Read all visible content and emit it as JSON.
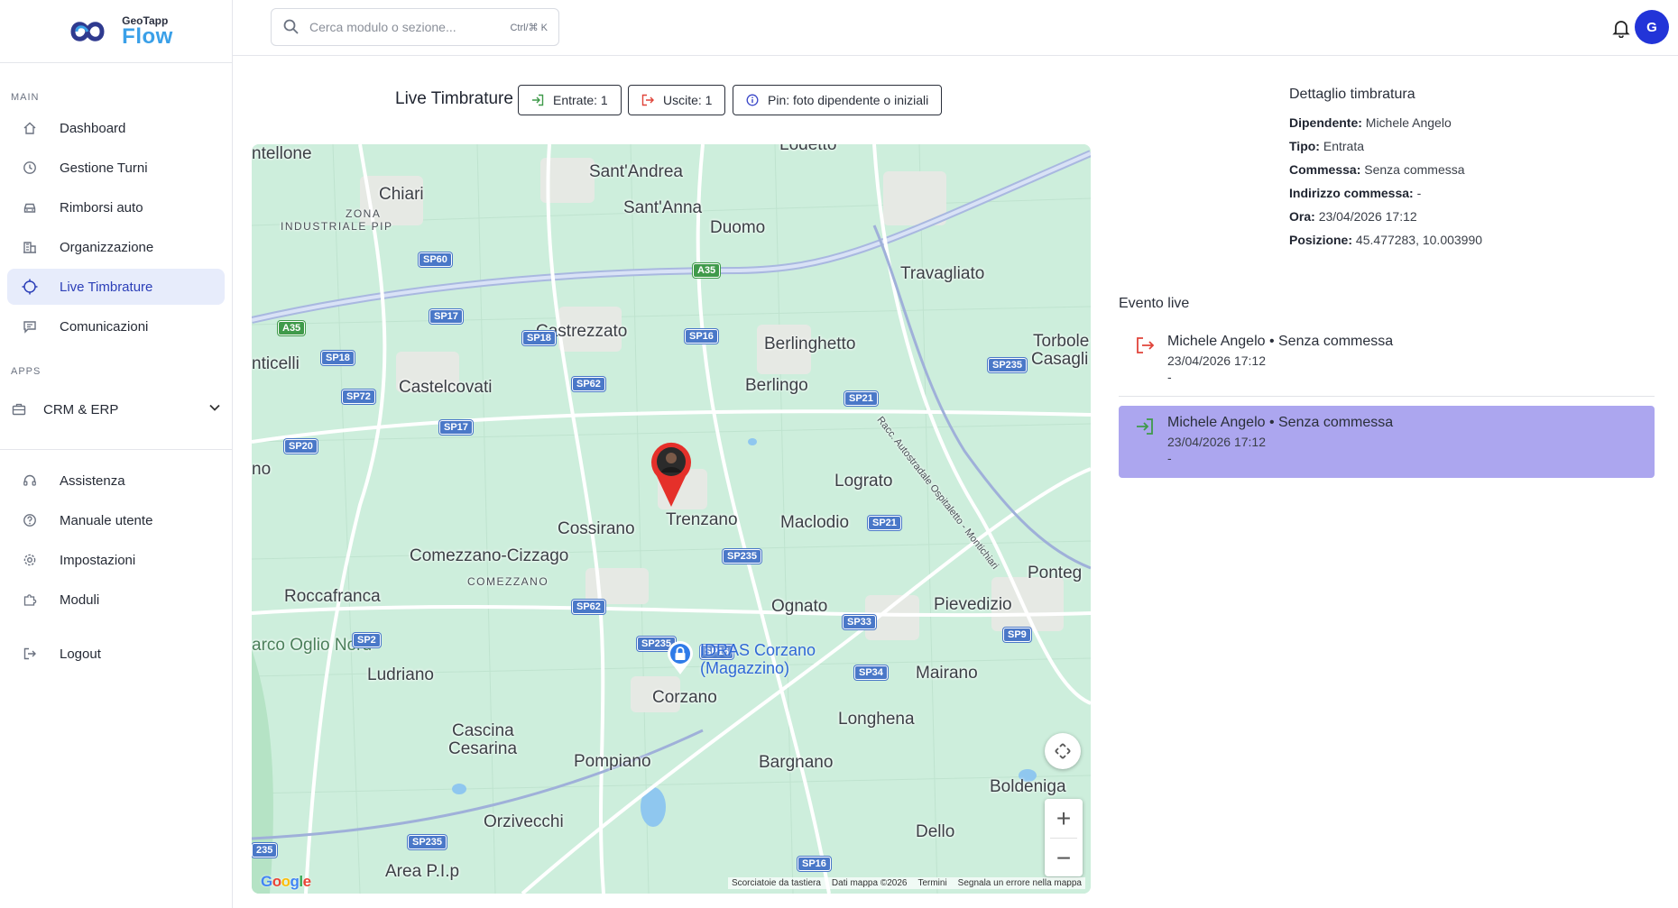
{
  "app": {
    "logo_top": "GeoTapp",
    "logo_bottom": "Flow"
  },
  "sidebar": {
    "main_label": "MAIN",
    "apps_label": "APPS",
    "items": [
      {
        "label": "Dashboard",
        "icon": "home-icon"
      },
      {
        "label": "Gestione Turni",
        "icon": "clock-icon"
      },
      {
        "label": "Rimborsi auto",
        "icon": "car-icon"
      },
      {
        "label": "Organizzazione",
        "icon": "building-icon"
      },
      {
        "label": "Live Timbrature",
        "icon": "crosshair-icon",
        "active": true
      },
      {
        "label": "Comunicazioni",
        "icon": "chat-icon"
      }
    ],
    "crm": {
      "label": "CRM & ERP",
      "icon": "briefcase-icon"
    },
    "bottom_items": [
      {
        "label": "Assistenza",
        "icon": "headset-icon"
      },
      {
        "label": "Manuale utente",
        "icon": "help-circle-icon"
      },
      {
        "label": "Impostazioni",
        "icon": "gear-icon"
      },
      {
        "label": "Moduli",
        "icon": "puzzle-icon"
      }
    ],
    "logout": {
      "label": "Logout",
      "icon": "logout-icon"
    }
  },
  "topbar": {
    "search_placeholder": "Cerca modulo o sezione...",
    "search_shortcut": "Ctrl/⌘ K",
    "avatar_initial": "G"
  },
  "header": {
    "title": "Live Timbrature",
    "chip_entrate": "Entrate: 1",
    "chip_uscite": "Uscite: 1",
    "chip_pin": "Pin: foto dipendente o iniziali"
  },
  "map": {
    "places": {
      "lodetto": "Lodetto",
      "santandrea": "Sant'Andrea",
      "santanna": "Sant'Anna",
      "duomo": "Duomo",
      "chiari": "Chiari",
      "zona1": "ZONA",
      "zona2": "INDUSTRIALE PIP",
      "travagliato": "Travagliato",
      "castrezzato": "Castrezzato",
      "berlinghetto": "Berlinghetto",
      "torbole": "Torbole",
      "casaglia": "Casagli",
      "nticelli": "nticelli",
      "castelcovati": "Castelcovati",
      "berlingo": "Berlingo",
      "ntellone": "ntellone",
      "lograto": "Lograto",
      "no": "no",
      "cossirano": "Cossirano",
      "trenzano": "Trenzano",
      "maclodio": "Maclodio",
      "comezzano_cizzago": "Comezzano-Cizzago",
      "comezzano": "COMEZZANO",
      "ponteg": "Ponteg",
      "roccafranca": "Roccafranca",
      "ognato": "Ognato",
      "pievedizio": "Pievedizio",
      "oglio": "arco Oglio Nord",
      "ludriano": "Ludriano",
      "mairano": "Mairano",
      "corzano": "Corzano",
      "longhena": "Longhena",
      "cascina": "Cascina",
      "cesarina": "Cesarina",
      "pompiano": "Pompiano",
      "bargnano": "Bargnano",
      "boldeniga": "Boldeniga",
      "orzivecchi": "Orzivecchi",
      "dello": "Dello",
      "area_pip": "Area P.I.p",
      "autostrada": "Racc. Autostradale Ospitaletto - Montichiari"
    },
    "poi_line1": "IDRAS Corzano",
    "poi_line2": "(Magazzino)",
    "google": "Google",
    "attribution": [
      "Scorciatoie da tastiera",
      "Dati mappa ©2026",
      "Termini",
      "Segnala un errore nella mappa"
    ],
    "zoom_in": "+",
    "zoom_out": "−"
  },
  "detail": {
    "title": "Dettaglio timbratura",
    "dipendente_label": "Dipendente:",
    "dipendente": "Michele Angelo",
    "tipo_label": "Tipo:",
    "tipo": "Entrata",
    "commessa_label": "Commessa:",
    "commessa": "Senza commessa",
    "indirizzo_label": "Indirizzo commessa:",
    "indirizzo": "-",
    "ora_label": "Ora:",
    "ora": "23/04/2026 17:12",
    "posizione_label": "Posizione:",
    "posizione": "45.477283, 10.003990"
  },
  "live": {
    "title": "Evento live",
    "events": [
      {
        "type": "uscita",
        "title": "Michele Angelo • Senza commessa",
        "time": "23/04/2026 17:12",
        "extra": "-"
      },
      {
        "type": "entrata",
        "title": "Michele Angelo • Senza commessa",
        "time": "23/04/2026 17:12",
        "extra": "-"
      }
    ]
  },
  "colors": {
    "accent": "#2234d8",
    "active_bg": "#e7ecfb",
    "entrata": "#3f9a4a",
    "uscita": "#e0443a",
    "selected_event": "#aca6ef",
    "map_bg": "#cfeedd"
  }
}
